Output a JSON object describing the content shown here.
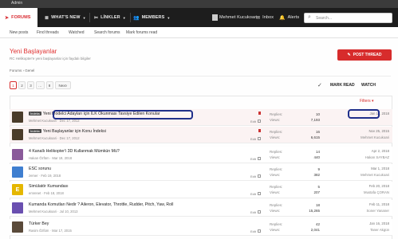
{
  "admin_bar": {
    "label": "Admin"
  },
  "nav": {
    "tabs": [
      {
        "icon": "paper-plane-icon",
        "label": "FORUMS"
      },
      {
        "icon": "list-icon",
        "label": "WHAT'S NEW"
      },
      {
        "icon": "link-icon",
        "label": "LİNKLER"
      },
      {
        "icon": "users-icon",
        "label": "MEMBERS"
      }
    ],
    "user": "Mehmet Kucukoari",
    "inbox": "Inbox",
    "alerts": "Alerts",
    "search_placeholder": "Search..."
  },
  "subnav": {
    "items": [
      "New posts",
      "Find threads",
      "Watched",
      "Search forums",
      "Mark forums read"
    ]
  },
  "page": {
    "title": "Yeni Başlayanlar",
    "description": "RC Helikopter'e yeni başlayanlar için faydalı bilgiler",
    "post_button": "POST THREAD"
  },
  "breadcrumb": {
    "items": [
      "Forums",
      "Genel"
    ]
  },
  "pagination": {
    "pages": [
      "1",
      "2",
      "3",
      "…",
      "8"
    ],
    "current": "1",
    "next": "Next"
  },
  "toolbar": {
    "mark_read": "MARK READ",
    "watch": "WATCH",
    "filters": "Filters"
  },
  "threads": [
    {
      "avatar_color": "#4a3b2a",
      "avatar_letter": "",
      "prefix": "İndeks",
      "title": "Yeni Modelci Adayları için İLK Okunması Tavsiye Edilen Konular",
      "author": "Mehmet Kucukoari",
      "date": "Dec 17, 2012",
      "edit": "Edit",
      "replies_label": "Replies:",
      "replies": "10",
      "views_label": "Views:",
      "views": "7,193",
      "last_date": "Jan 11, 2018",
      "last_user": "",
      "sticky": true
    },
    {
      "avatar_color": "#4a3b2a",
      "avatar_letter": "",
      "prefix": "İndeks",
      "title": "Yeni Başlayanlar için Konu İndeksi",
      "author": "Mehmet Kucukoari",
      "date": "Dec 17, 2012",
      "edit": "Edit",
      "replies_label": "Replies:",
      "replies": "16",
      "views_label": "Views:",
      "views": "6,615",
      "last_date": "Nov 25, 2015",
      "last_user": "Mehmet Kucukoari",
      "sticky": true
    },
    {
      "avatar_color": "#8a5a9a",
      "avatar_letter": "",
      "prefix": "",
      "title": "4 Kanallı Helikopter'i 3D Kullanmak Mümkün Mü?",
      "author": "Hakan Özfüm",
      "date": "Mar 19, 2018",
      "edit": "Edit",
      "replies_label": "Replies:",
      "replies": "14",
      "views_label": "Views:",
      "views": "440",
      "last_date": "Apr 2, 2018",
      "last_user": "Hakan SAYBAZ",
      "sticky": false
    },
    {
      "avatar_color": "#3f7fd0",
      "avatar_letter": "",
      "prefix": "",
      "title": "ESC sorunu",
      "author": "zemer",
      "date": "Feb 19, 2018",
      "edit": "Edit",
      "replies_label": "Replies:",
      "replies": "9",
      "views_label": "Views:",
      "views": "382",
      "last_date": "Mar 1, 2018",
      "last_user": "Mehmet Kucukoari",
      "sticky": false
    },
    {
      "avatar_color": "#e5b700",
      "avatar_letter": "E",
      "prefix": "",
      "title": "Simülatör Kumandası",
      "author": "emrenet",
      "date": "Feb 18, 2018",
      "edit": "Edit",
      "replies_label": "Replies:",
      "replies": "5",
      "views_label": "Views:",
      "views": "207",
      "last_date": "Feb 20, 2018",
      "last_user": "Mustafa ÇORAN",
      "sticky": false
    },
    {
      "avatar_color": "#6a4fb0",
      "avatar_letter": "",
      "prefix": "",
      "title": "Kumanda Komutları Nedir ? Aileron, Elevator, Throttle, Rudder, Pitch, Yaw, Roll",
      "author": "Mehmet Kucukoari",
      "date": "Jul 10, 2013",
      "edit": "Edit",
      "replies_label": "Replies:",
      "replies": "18",
      "views_label": "Views:",
      "views": "15,265",
      "last_date": "Feb 11, 2018",
      "last_user": "Soner Yananer",
      "sticky": false
    },
    {
      "avatar_color": "#5a4a3a",
      "avatar_letter": "",
      "prefix": "",
      "title": "Türker Bey",
      "author": "Rasim Özfüm",
      "date": "Mar 17, 2015",
      "edit": "Edit",
      "replies_label": "Replies:",
      "replies": "42",
      "views_label": "Views:",
      "views": "2,041",
      "last_date": "Jan 16, 2018",
      "last_user": "Taner Akgün",
      "sticky": false
    }
  ]
}
